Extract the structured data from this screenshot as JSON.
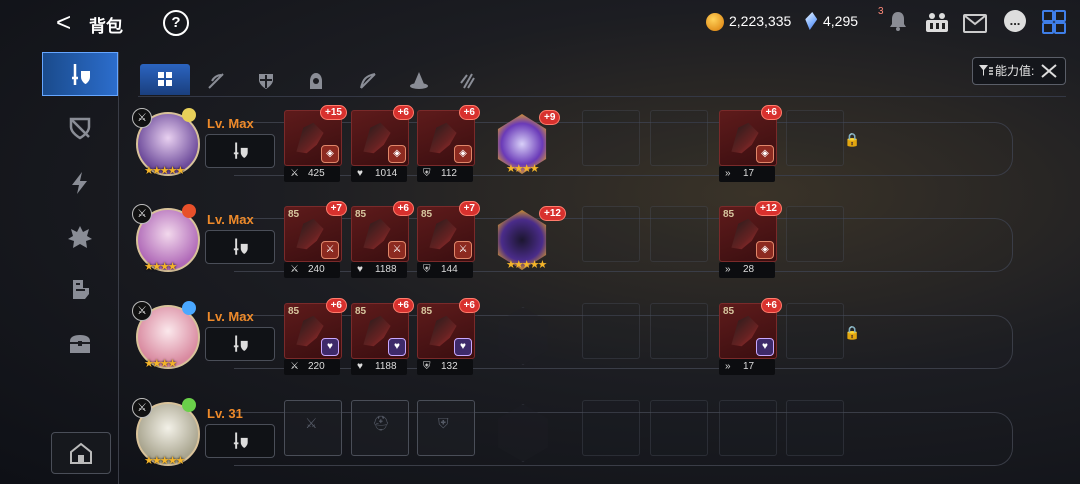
{
  "header": {
    "back_glyph": "<",
    "title": "背包",
    "help_glyph": "?",
    "gold": "2,223,335",
    "gems": "4,295",
    "notification_count": "3",
    "chat_glyph": "..."
  },
  "sidebar": {
    "items": [
      {
        "icon": "sword-shield-icon",
        "active": true
      },
      {
        "icon": "broken-shield-icon"
      },
      {
        "icon": "lightning-icon"
      },
      {
        "icon": "spiky-creature-icon"
      },
      {
        "icon": "boot-icon"
      },
      {
        "icon": "treasure-chest-icon"
      }
    ],
    "home_icon": "camp-icon"
  },
  "tabs": [
    {
      "icon": "grid-all-icon",
      "active": true
    },
    {
      "icon": "weapon-slash-icon"
    },
    {
      "icon": "shield-icon"
    },
    {
      "icon": "hooded-figure-icon"
    },
    {
      "icon": "bow-icon"
    },
    {
      "icon": "wizard-hat-icon"
    },
    {
      "icon": "claw-scratch-icon"
    }
  ],
  "sort": {
    "label": "能力值:"
  },
  "heroes": [
    {
      "level": "Lv. Max",
      "stars": "★★★★★",
      "equipment": [
        {
          "item_level": "",
          "plus": "+15",
          "sub": "power",
          "stat_icon": "sword",
          "stat": "425"
        },
        {
          "item_level": "",
          "plus": "+6",
          "sub": "power",
          "stat_icon": "heart",
          "stat": "1014"
        },
        {
          "item_level": "",
          "plus": "+6",
          "sub": "power",
          "stat_icon": "shield",
          "stat": "112"
        }
      ],
      "artifact": {
        "plus": "+9",
        "stars": "★★★★"
      },
      "accessory": {
        "item_level": "",
        "plus": "+6",
        "stat": "17"
      },
      "locked": true
    },
    {
      "level": "Lv. Max",
      "stars": "★★★★",
      "equipment": [
        {
          "item_level": "85",
          "plus": "+7",
          "sub": "attack",
          "stat_icon": "sword",
          "stat": "240"
        },
        {
          "item_level": "85",
          "plus": "+6",
          "sub": "attack",
          "stat_icon": "heart",
          "stat": "1188"
        },
        {
          "item_level": "85",
          "plus": "+7",
          "sub": "attack",
          "stat_icon": "shield",
          "stat": "144"
        }
      ],
      "artifact": {
        "plus": "+12",
        "stars": "★★★★★"
      },
      "accessory": {
        "item_level": "85",
        "plus": "+12",
        "stat": "28"
      },
      "locked": false
    },
    {
      "level": "Lv. Max",
      "stars": "★★★★",
      "equipment": [
        {
          "item_level": "85",
          "plus": "+6",
          "sub": "heart",
          "stat_icon": "sword",
          "stat": "220"
        },
        {
          "item_level": "85",
          "plus": "+6",
          "sub": "heart",
          "stat_icon": "heart",
          "stat": "1188"
        },
        {
          "item_level": "85",
          "plus": "+6",
          "sub": "heart",
          "stat_icon": "shield",
          "stat": "132"
        }
      ],
      "artifact": null,
      "accessory": {
        "item_level": "85",
        "plus": "+6",
        "stat": "17"
      },
      "locked": true
    },
    {
      "level": "Lv. 31",
      "stars": "★★★★★",
      "equipment": [],
      "artifact": null,
      "accessory": null,
      "locked": false
    }
  ],
  "colors": {
    "accent": "#2c6dcc",
    "level": "#ee8a2a",
    "item_frame": "#5e1b1b",
    "plus_badge": "#d8312e"
  }
}
